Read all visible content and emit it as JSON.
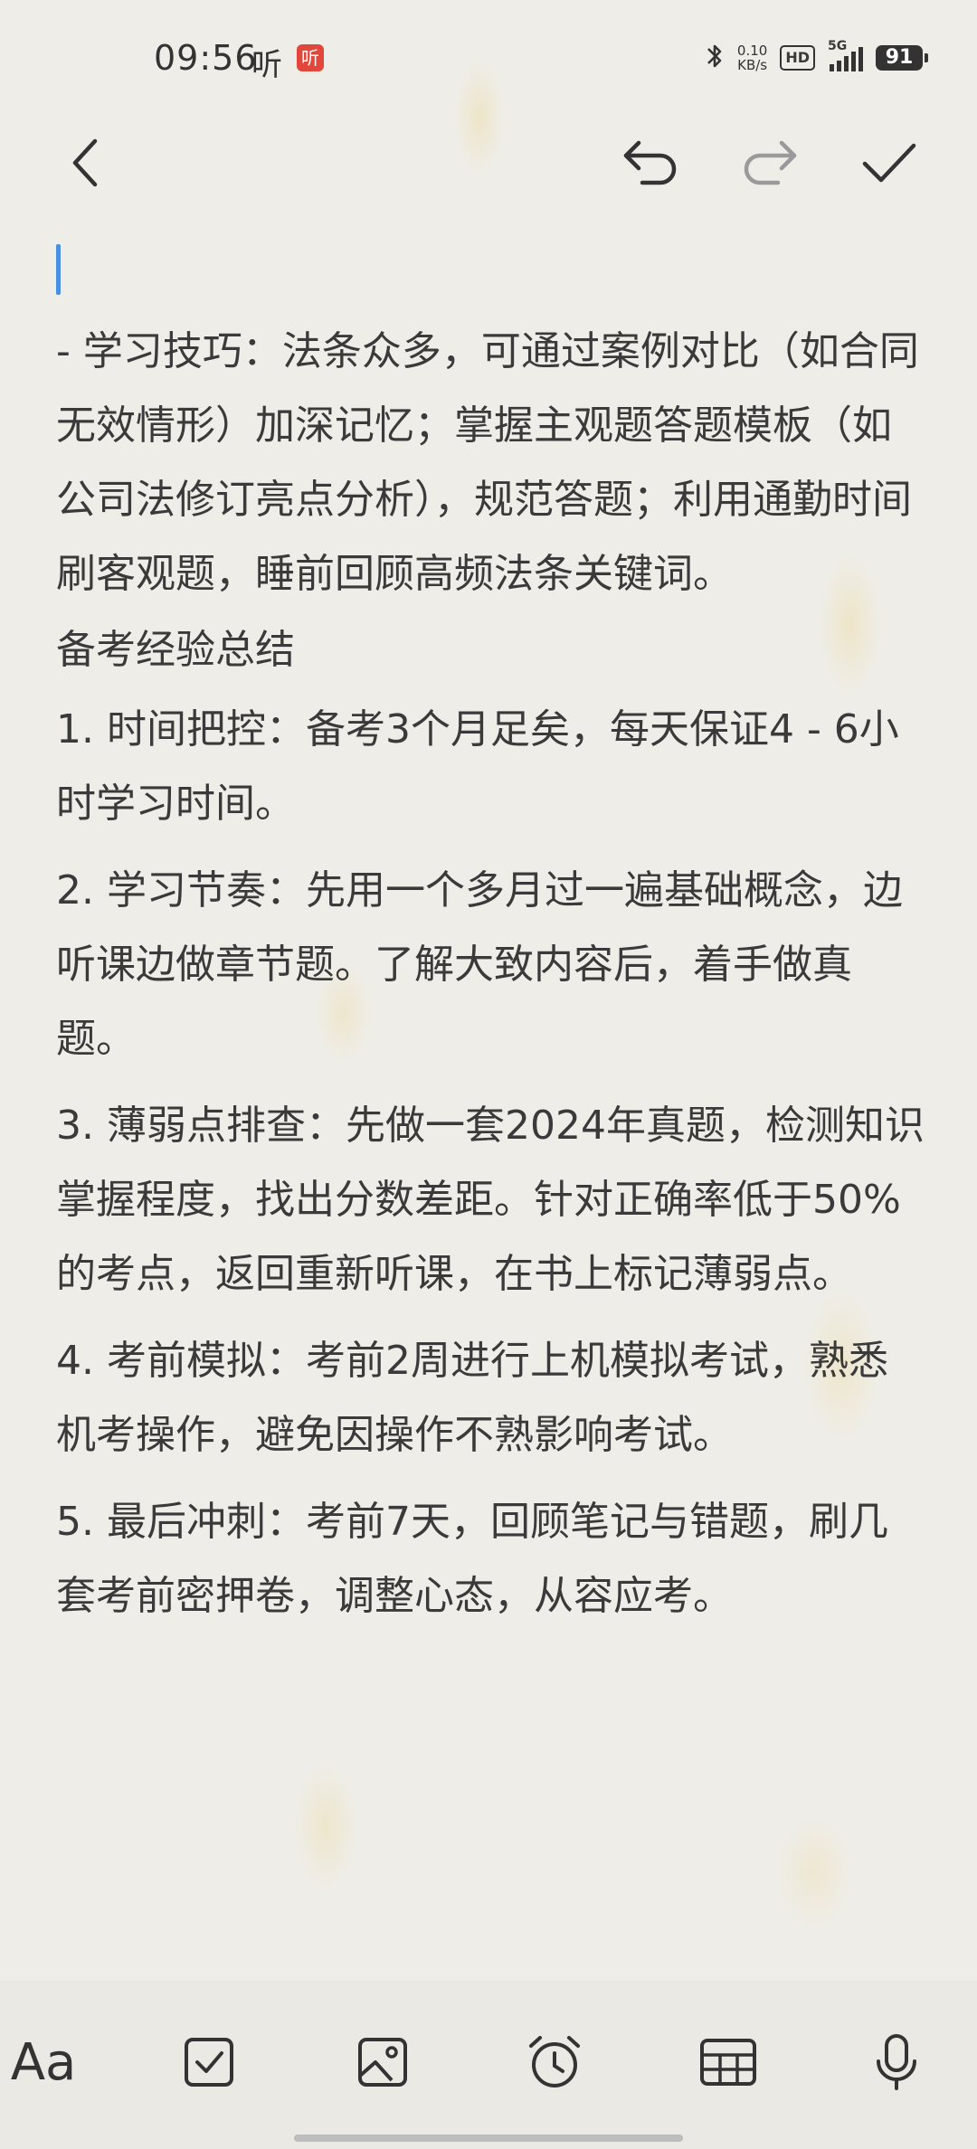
{
  "status_bar": {
    "time": "09:56",
    "ting_text": "听",
    "ting_badge": "听",
    "net_speed_value": "0.10",
    "net_speed_unit": "KB/s",
    "hd": "HD",
    "signal": "5G",
    "battery": "91"
  },
  "toolbar": {
    "back_icon": "chevron-left",
    "undo_icon": "undo-arrow",
    "redo_icon": "redo-arrow",
    "done_icon": "checkmark"
  },
  "note": {
    "paragraphs": [
      "- 学习技巧：法条众多，可通过案例对比（如合同无效情形）加深记忆；掌握主观题答题模板（如公司法修订亮点分析），规范答题；利用通勤时间刷客观题，睡前回顾高频法条关键词。",
      "备考经验总结",
      "1. 时间把控：备考3个月足矣，每天保证4 - 6小时学习时间。",
      "2. 学习节奏：先用一个多月过一遍基础概念，边听课边做章节题。了解大致内容后，着手做真题。",
      "3. 薄弱点排查：先做一套2024年真题，检测知识掌握程度，找出分数差距。针对正确率低于50%的考点，返回重新听课，在书上标记薄弱点。",
      "4. 考前模拟：考前2周进行上机模拟考试，熟悉机考操作，避免因操作不熟影响考试。",
      "5. 最后冲刺：考前7天，回顾笔记与错题，刷几套考前密押卷，调整心态，从容应考。"
    ]
  },
  "bottom_bar": {
    "font_button": "Aa",
    "icons": [
      "checkbox-icon",
      "image-icon",
      "alarm-clock-icon",
      "table-icon",
      "microphone-icon"
    ]
  },
  "colors": {
    "background": "#efede8",
    "text": "#3a3a3a",
    "cursor": "#4a90e2",
    "badge": "#e2473b"
  }
}
